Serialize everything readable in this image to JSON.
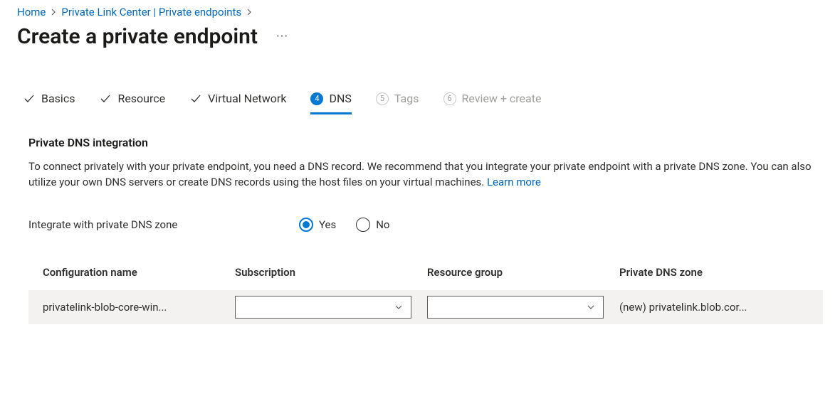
{
  "breadcrumb": {
    "home": "Home",
    "center": "Private Link Center | Private endpoints"
  },
  "page": {
    "title": "Create a private endpoint"
  },
  "steps": {
    "basics": "Basics",
    "resource": "Resource",
    "vnet": "Virtual Network",
    "dns_num": "4",
    "dns": "DNS",
    "tags_num": "5",
    "tags": "Tags",
    "review_num": "6",
    "review": "Review + create"
  },
  "section": {
    "heading": "Private DNS integration",
    "description": "To connect privately with your private endpoint, you need a DNS record. We recommend that you integrate your private endpoint with a private DNS zone. You can also utilize your own DNS servers or create DNS records using the host files on your virtual machines.  ",
    "learn_more": "Learn more"
  },
  "form": {
    "integrate_label": "Integrate with private DNS zone",
    "yes": "Yes",
    "no": "No"
  },
  "table": {
    "headers": {
      "config": "Configuration name",
      "sub": "Subscription",
      "rg": "Resource group",
      "zone": "Private DNS zone"
    },
    "row": {
      "config": "privatelink-blob-core-win...",
      "sub": "",
      "rg": "",
      "zone": "(new) privatelink.blob.cor..."
    }
  }
}
